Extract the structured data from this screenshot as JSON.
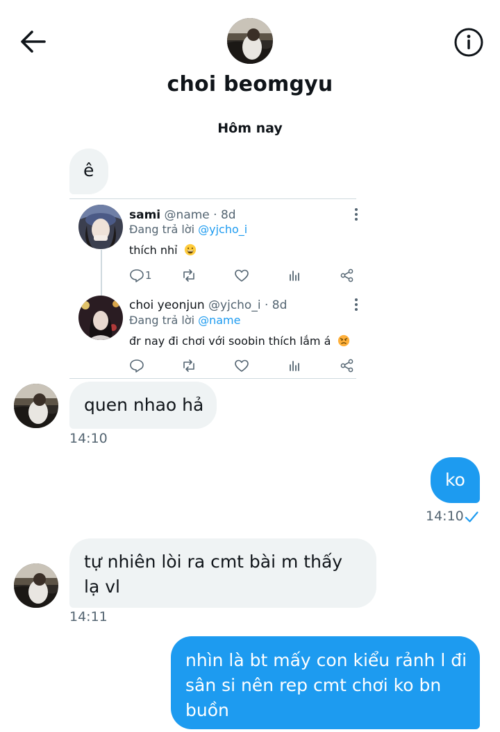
{
  "header": {
    "back_icon": "arrow-left-icon",
    "info_icon": "info-icon",
    "name": "choi beomgyu"
  },
  "date_separator": "Hôm nay",
  "messages": [
    {
      "side": "incoming",
      "text": "ê"
    },
    {
      "side": "incoming",
      "text": "quen nhao hả",
      "time": "14:10"
    },
    {
      "side": "outgoing",
      "text": "ko",
      "time": "14:10",
      "status": "read"
    },
    {
      "side": "incoming",
      "text": "tự nhiên lòi ra cmt bài m thấy lạ vl",
      "time": "14:11"
    },
    {
      "side": "outgoing",
      "text": "nhìn là bt mấy con kiểu rảnh l đi sân si nên rep cmt chơi ko bn buồn"
    }
  ],
  "shared_tweets": [
    {
      "name": "sami",
      "handle": "@name",
      "age": "8d",
      "reply_prefix": "Đang trả lời",
      "reply_to": "@yjcho_i",
      "text": "thích nhỉ",
      "emoji": "grinning-face",
      "reply_count": "1"
    },
    {
      "name": "choi yeonjun",
      "handle": "@yjcho_i",
      "age": "8d",
      "reply_prefix": "Đang trả lời",
      "reply_to": "@name",
      "text": "đr nay đi chơi với soobin thích lắm á",
      "emoji": "angry-face",
      "reply_count": ""
    }
  ],
  "colors": {
    "accent": "#1d9bf0",
    "incoming_bubble": "#eff3f4",
    "secondary_text": "#536471"
  }
}
